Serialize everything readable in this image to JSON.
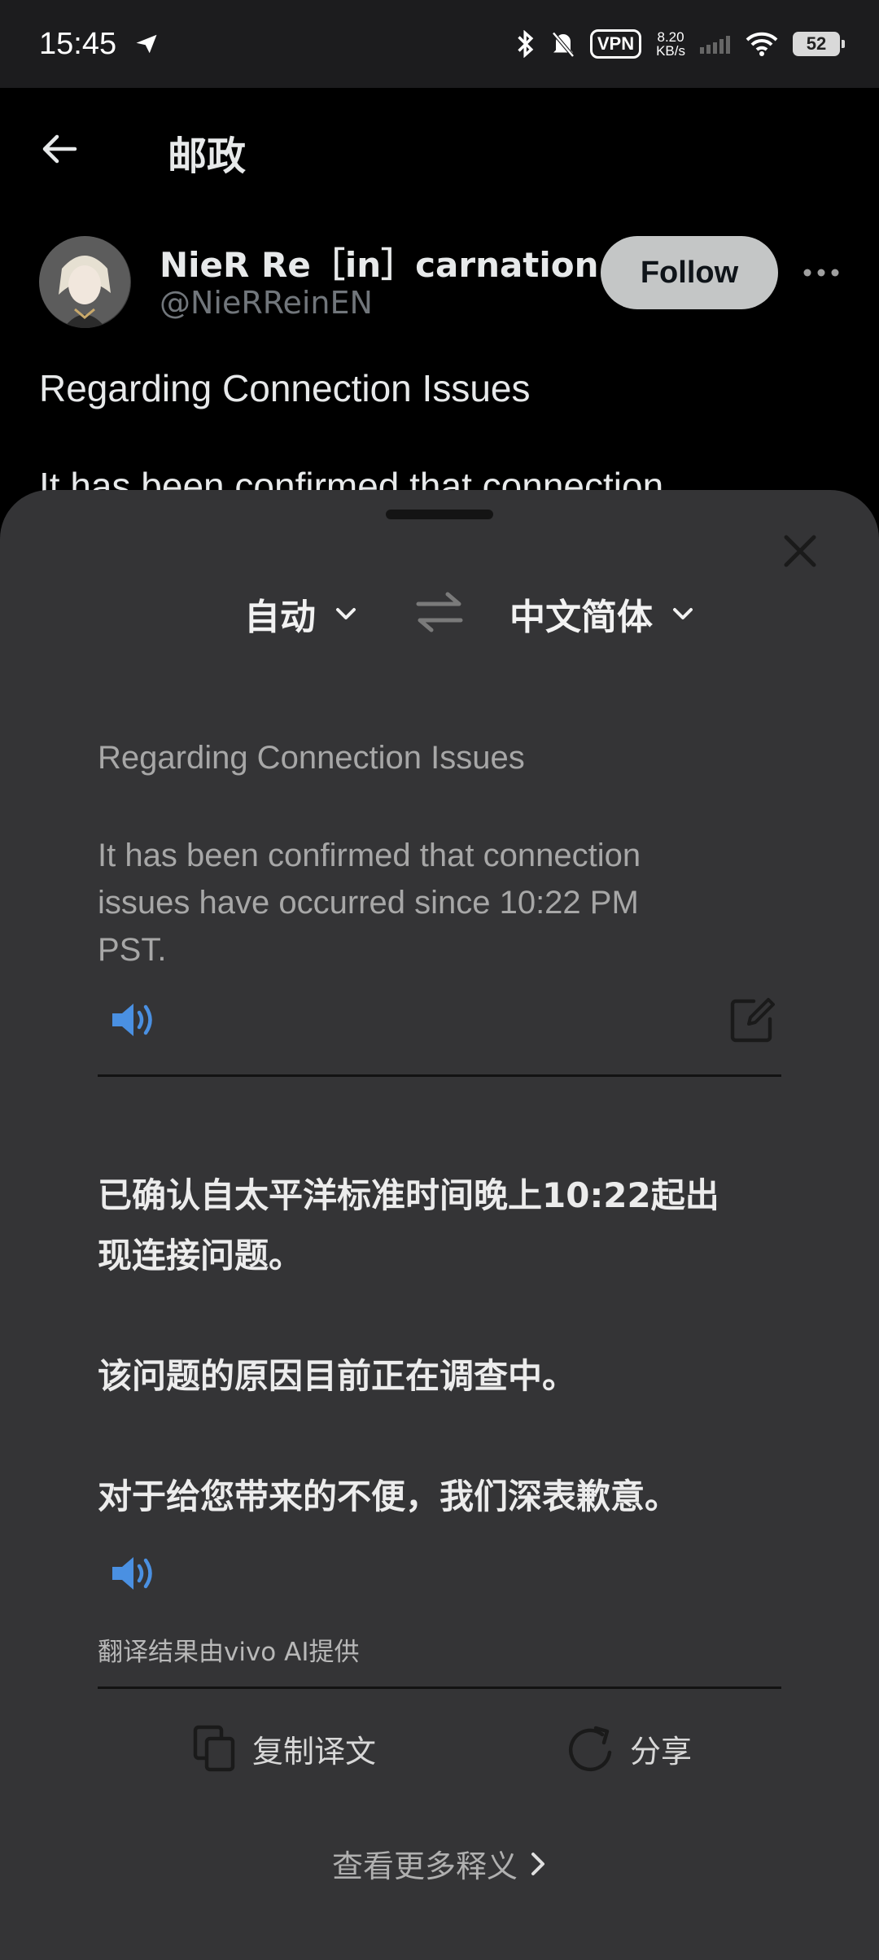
{
  "status_bar": {
    "time": "15:45",
    "vpn": "VPN",
    "speed_value": "8.20",
    "speed_unit": "KB/s",
    "battery": "52"
  },
  "header": {
    "title": "邮政"
  },
  "tweet": {
    "author_name": "NieR Re［in］carnation EN",
    "author_handle": "@NieRReinEN",
    "follow_label": "Follow",
    "heading": "Regarding Connection Issues",
    "peek_text": "It has been confirmed that connection"
  },
  "translator": {
    "source_lang": "自动",
    "target_lang": "中文简体",
    "source_lines": [
      "Regarding Connection Issues",
      "It has been confirmed that connection",
      "issues have occurred since 10:22 PM",
      "PST."
    ],
    "translation_lines": [
      "已确认自太平洋标准时间晚上10:22起出",
      "现连接问题。",
      "该问题的原因目前正在调查中。",
      "对于给您带来的不便，我们深表歉意。"
    ],
    "credit": "翻译结果由vivo AI提供",
    "copy_label": "复制译文",
    "share_label": "分享",
    "more_label": "查看更多释义",
    "accent_color": "#4a90e2"
  }
}
